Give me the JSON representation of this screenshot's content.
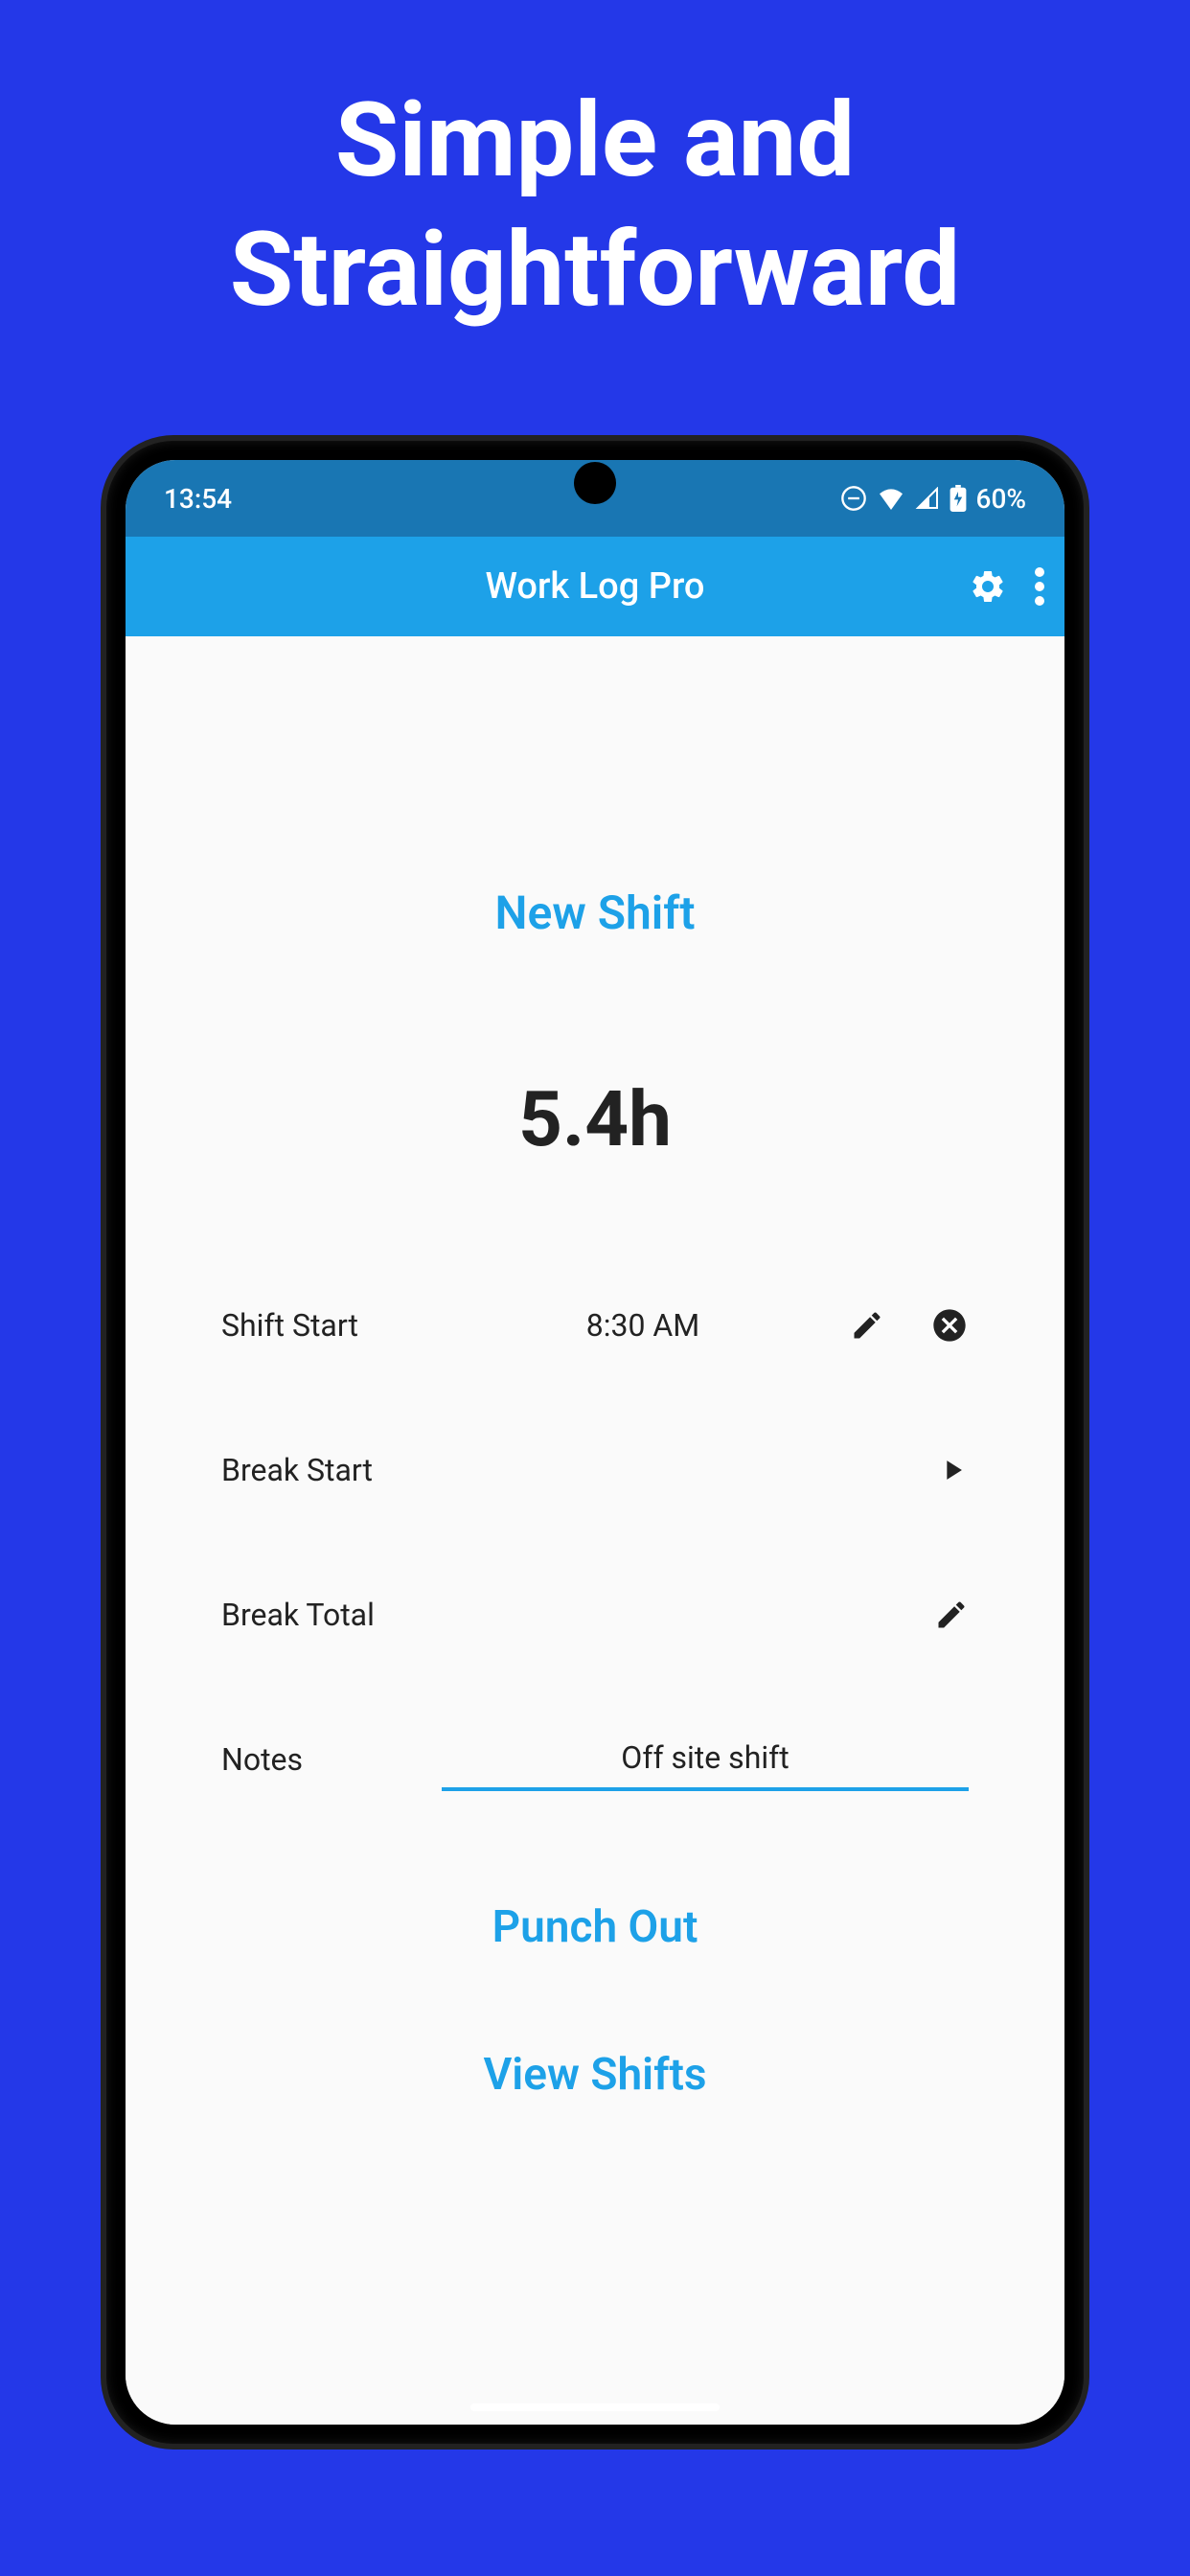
{
  "promo": {
    "title": "Simple and Straightforward"
  },
  "status_bar": {
    "time": "13:54",
    "battery": "60%"
  },
  "app_bar": {
    "title": "Work Log Pro"
  },
  "content": {
    "section_title": "New Shift",
    "duration": "5.4h",
    "rows": {
      "shift_start": {
        "label": "Shift Start",
        "value": "8:30 AM"
      },
      "break_start": {
        "label": "Break Start",
        "value": ""
      },
      "break_total": {
        "label": "Break Total",
        "value": ""
      },
      "notes": {
        "label": "Notes",
        "value": "Off site shift"
      }
    },
    "punch_out": "Punch Out",
    "view_shifts": "View Shifts"
  }
}
